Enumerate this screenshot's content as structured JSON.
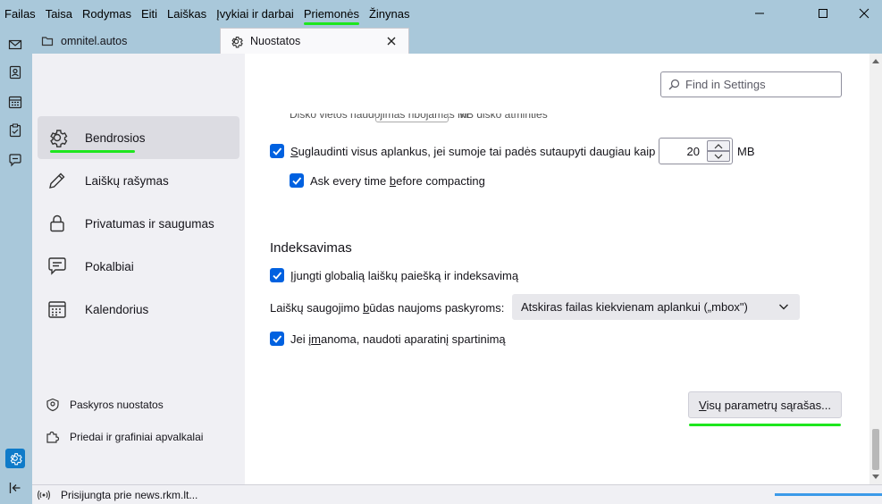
{
  "menubar": {
    "items": [
      {
        "label": "Failas"
      },
      {
        "label": "Taisa"
      },
      {
        "label": "Rodymas"
      },
      {
        "label": "Eiti"
      },
      {
        "label": "Laiškas"
      },
      {
        "label": "Įvykiai ir darbai"
      },
      {
        "label": "Priemonės"
      },
      {
        "label": "Žinynas"
      }
    ],
    "highlighted_index": 6
  },
  "tabs": [
    {
      "label": "omnitel.autos",
      "icon": "folder-icon"
    },
    {
      "label": "Nuostatos",
      "icon": "gear-icon"
    }
  ],
  "search": {
    "placeholder": "Find in Settings"
  },
  "sidebar": {
    "categories": [
      {
        "label": "Bendrosios",
        "icon": "gear-icon",
        "selected": true
      },
      {
        "label": "Laiškų rašymas",
        "icon": "pencil-icon"
      },
      {
        "label": "Privatumas ir saugumas",
        "icon": "lock-icon"
      },
      {
        "label": "Pokalbiai",
        "icon": "chat-icon"
      },
      {
        "label": "Kalendorius",
        "icon": "calendar-icon"
      }
    ],
    "footer": [
      {
        "label": "Paskyros nuostatos",
        "icon": "account-icon"
      },
      {
        "label": "Priedai ir grafiniai apvalkalai",
        "icon": "puzzle-icon"
      }
    ]
  },
  "partial_row": {
    "text": "Disko vietos naudojimas ribojamas iki",
    "unit": "MB disko atminties"
  },
  "compact": {
    "checked": true,
    "label_pre": "",
    "label_u": "S",
    "label_post": "uglaudinti visus aplankus, jei sumoje tai padės sutaupyti daugiau kaip",
    "value": "20",
    "unit": "MB"
  },
  "ask_compact": {
    "checked": true,
    "label_pre": "Ask every time ",
    "label_u": "b",
    "label_post": "efore compacting"
  },
  "indexing": {
    "title": "Indeksavimas",
    "global_search": {
      "checked": true,
      "label_pre": "Į",
      "label_u": "j",
      "label_post": "ungti globalią laiškų paiešką ir indeksavimą"
    },
    "storage_label_pre": "Laiškų saugojimo ",
    "storage_label_u": "b",
    "storage_label_post": "ūdas naujoms paskyroms:",
    "storage_value": "Atskiras failas kiekvienam aplankui („mbox\")",
    "hw_accel": {
      "checked": true,
      "label_pre": "Jei į",
      "label_u": "m",
      "label_post": "anoma, naudoti aparatinį spartinimą"
    }
  },
  "config_button": {
    "label_pre": "",
    "label_u": "V",
    "label_post": "isų parametrų sąrašas..."
  },
  "status": {
    "text": "Prisijungta prie news.rkm.lt...",
    "progress": 1.0
  },
  "colors": {
    "accent": "#0061e0",
    "highlight": "#1ee61e",
    "titlebar": "#a9c8da"
  }
}
